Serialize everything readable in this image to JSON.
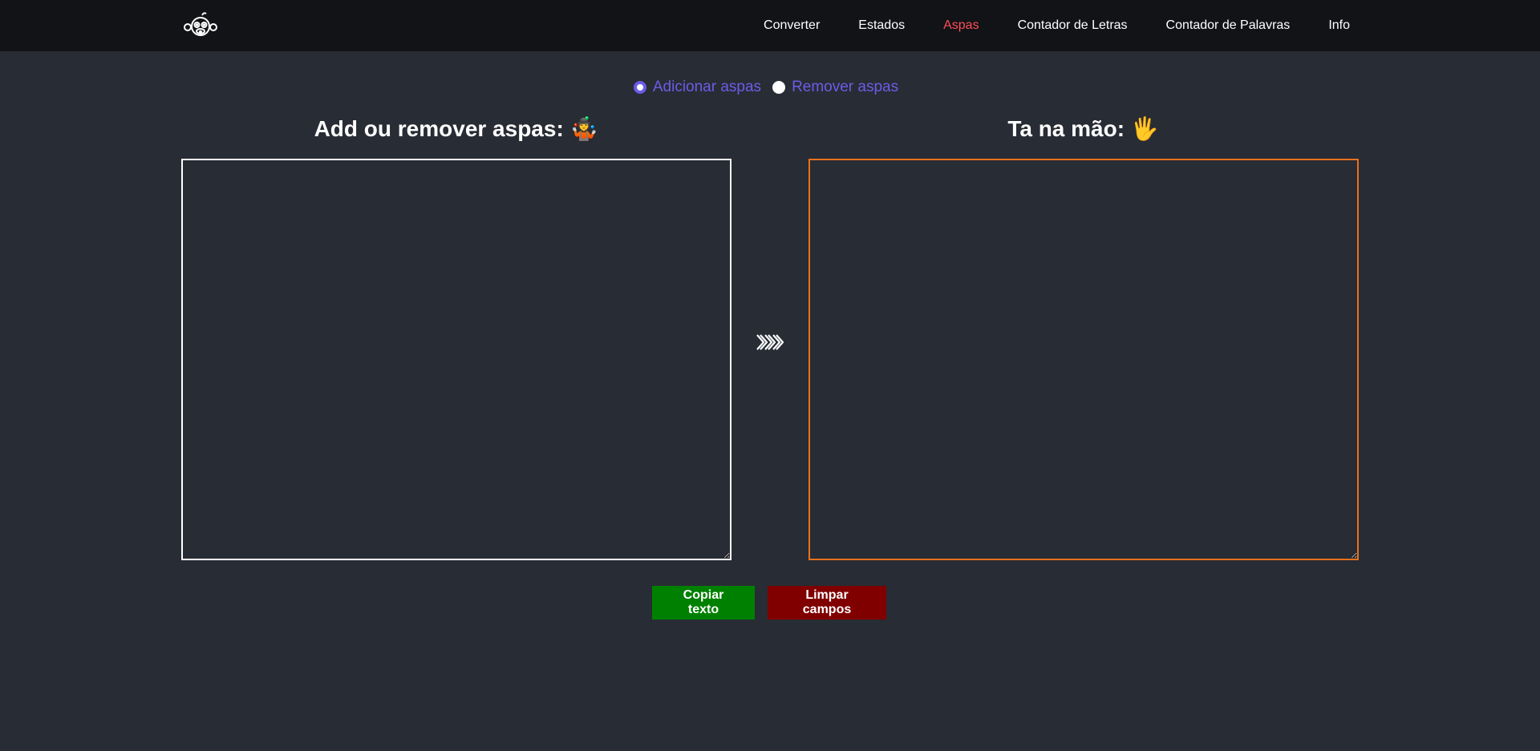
{
  "nav": {
    "logo_icon": "monkey-face-icon",
    "links": [
      {
        "label": "Converter"
      },
      {
        "label": "Estados"
      },
      {
        "label": "Aspas",
        "active": true
      },
      {
        "label": "Contador de Letras"
      },
      {
        "label": "Contador de Palavras"
      },
      {
        "label": "Info"
      }
    ]
  },
  "mode": {
    "options": [
      {
        "label": "Adicionar aspas",
        "checked": true
      },
      {
        "label": "Remover aspas",
        "checked": false
      }
    ]
  },
  "input": {
    "heading": "Add ou remover aspas: 🤹",
    "value": "",
    "border_color": "#ffffff"
  },
  "output": {
    "heading": "Ta na mão: 🖐️",
    "value": "",
    "border_color": "#e8711c"
  },
  "arrow_icon": "triple-chevron-right-icon",
  "buttons": {
    "copy_label": "Copiar texto",
    "clear_label": "Limpar campos"
  },
  "colors": {
    "background": "#282c34",
    "navbar": "#111317",
    "accent_purple": "#6c5ce7",
    "active_link": "#ff4d5a",
    "copy_button": "#008000",
    "clear_button": "#800000"
  }
}
